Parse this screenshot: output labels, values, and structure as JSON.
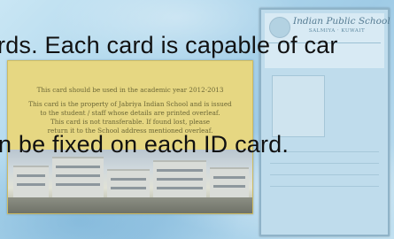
{
  "slide": {
    "caption_line_1": "rds. Each card is capable of car",
    "caption_line_2": "n be fixed on each ID card."
  },
  "card_back": {
    "note_lines": [
      "This card should be used in the academic year 2012-2013",
      "This card is the property of Jabriya Indian School and is issued",
      "to the student / staff whose details are printed overleaf.",
      "This card is not transferable. If found lost, please",
      "return it to the School address mentioned overleaf."
    ]
  },
  "card_front": {
    "school_name": "Indian Public School",
    "school_place": "SALMIYA · KUWAIT"
  },
  "colors": {
    "background": "#aed6ec",
    "card_back": "#e6d782",
    "card_front": "#bfdcec"
  }
}
